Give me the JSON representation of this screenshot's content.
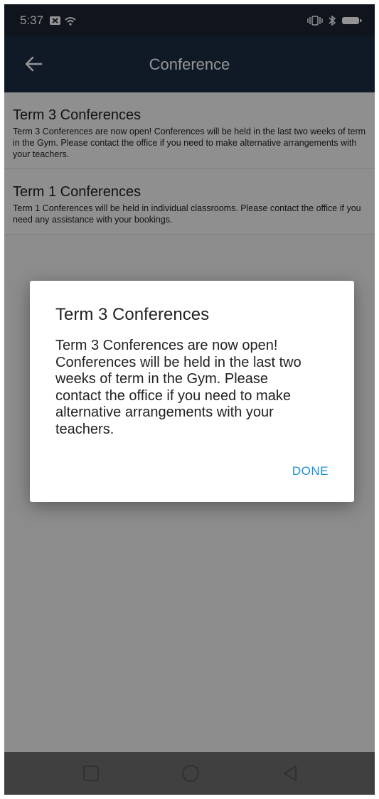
{
  "status_bar": {
    "time": "5:37"
  },
  "app_bar": {
    "title": "Conference",
    "back_icon": "arrow-left-icon"
  },
  "list": {
    "items": [
      {
        "title": "Term 3 Conferences",
        "body": "Term 3 Conferences are now open! Conferences will be held in the last two weeks of term in the Gym. Please contact the office if you need to make alternative arrangements with your teachers."
      },
      {
        "title": "Term 1 Conferences",
        "body": "Term 1 Conferences will be held in individual classrooms. Please contact the office if you need any assistance with your bookings."
      }
    ]
  },
  "dialog": {
    "title": "Term 3 Conferences",
    "body": "Term 3 Conferences are now open! Conferences will be held in the last two weeks of term in the Gym. Please contact the office if you need to make alternative arrangements with your teachers.",
    "done_label": "DONE"
  },
  "colors": {
    "status_bar_bg": "#1b2433",
    "app_bar_bg": "#1d2d44",
    "accent": "#1a8fd6"
  }
}
